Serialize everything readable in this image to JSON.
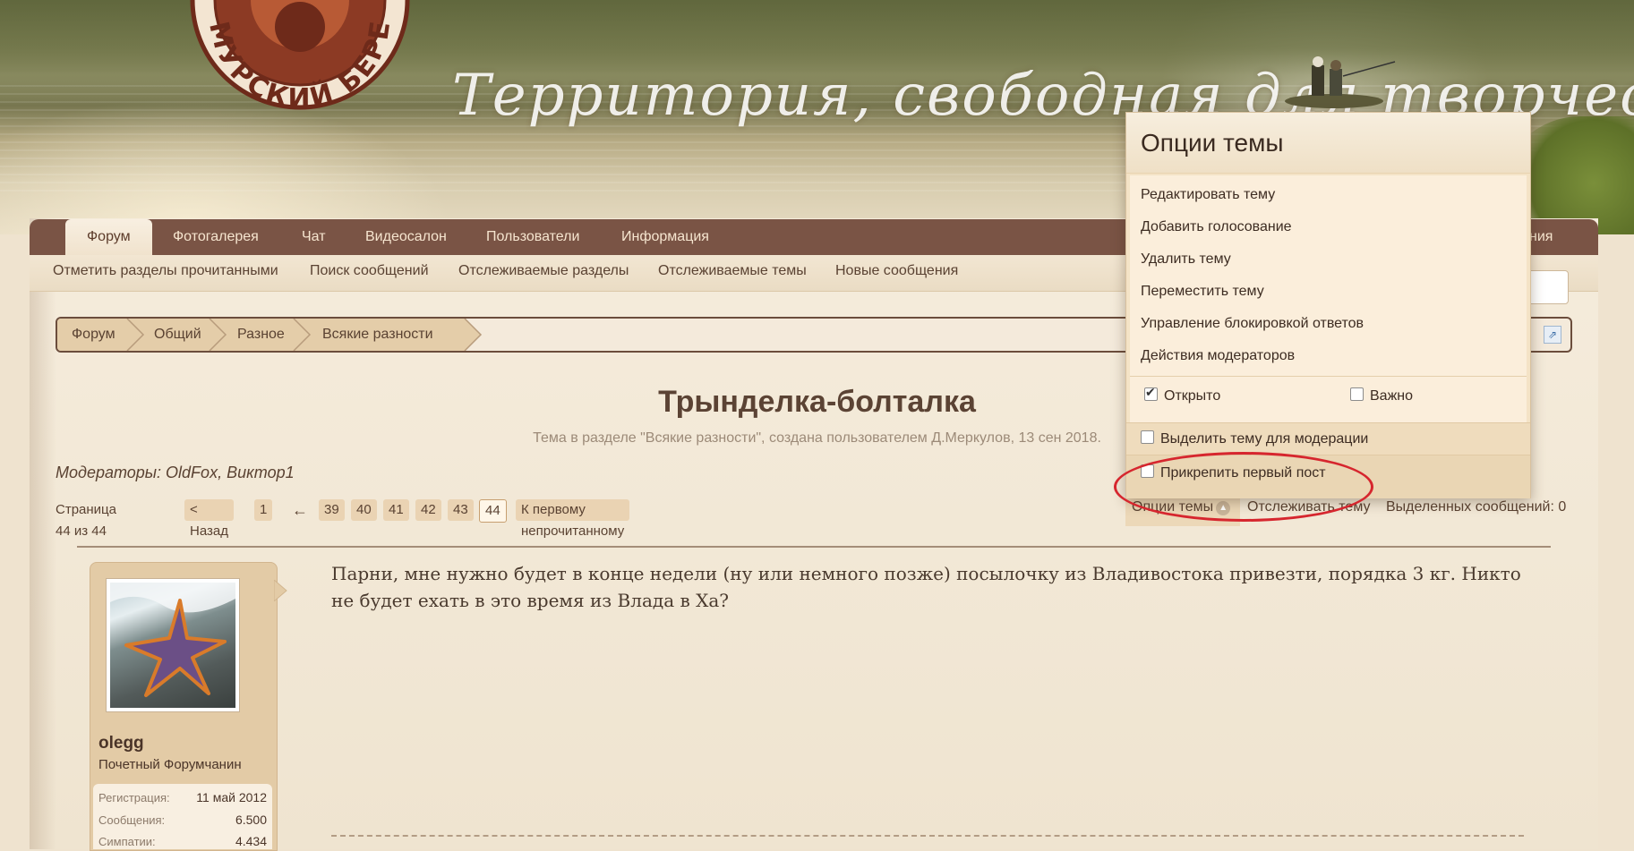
{
  "header": {
    "logo_text": "АМУРСКИЙ БЕРЕГ",
    "slogan": "Территория, свободная для творчества!"
  },
  "nav": {
    "tabs": [
      "Форум",
      "Фотогалерея",
      "Чат",
      "Видеосалон",
      "Пользователи",
      "Информация"
    ],
    "right_fragment": "ния"
  },
  "subnav": [
    "Отметить разделы прочитанными",
    "Поиск сообщений",
    "Отслеживаемые разделы",
    "Отслеживаемые темы",
    "Новые сообщения"
  ],
  "breadcrumb": [
    "Форум",
    "Общий",
    "Разное",
    "Всякие разности"
  ],
  "thread": {
    "title": "Трынделка-болталка",
    "meta": "Тема в разделе \"Всякие разности\", создана пользователем Д.Меркулов, 13 сен 2018.",
    "moderators": "Модераторы: OldFox, Виктор1"
  },
  "pagination": {
    "label": "Страница 44 из 44",
    "prev": "< Назад",
    "first": "1",
    "ellipsis": "←",
    "pages": [
      "39",
      "40",
      "41",
      "42",
      "43",
      "44"
    ],
    "current": "44",
    "unread": "К первому непрочитанному"
  },
  "tools": {
    "options": "Опции темы",
    "watch": "Отслеживать тему",
    "selected": "Выделенных сообщений: 0"
  },
  "menu": {
    "title": "Опции темы",
    "items": [
      "Редактировать тему",
      "Добавить голосование",
      "Удалить тему",
      "Переместить тему",
      "Управление блокировкой ответов",
      "Действия модераторов"
    ],
    "open_label": "Открыто",
    "open_checked": true,
    "important_label": "Важно",
    "important_checked": false,
    "moderation_label": "Выделить тему для модерации",
    "pin_label": "Прикрепить первый пост"
  },
  "post": {
    "username": "olegg",
    "user_title": "Почетный Форумчанин",
    "stats": [
      {
        "label": "Регистрация:",
        "value": "11 май 2012"
      },
      {
        "label": "Сообщения:",
        "value": "6.500"
      },
      {
        "label": "Симпатии:",
        "value": "4.434"
      }
    ],
    "text": "Парни, мне нужно будет в конце недели (ну или немного позже) посылочку из Владивостока привезти, порядка 3 кг. Никто не будет ехать в это время из Влада в Ха?"
  },
  "colors": {
    "nav_bg": "#7a5445",
    "accent_red": "#d6262e"
  }
}
